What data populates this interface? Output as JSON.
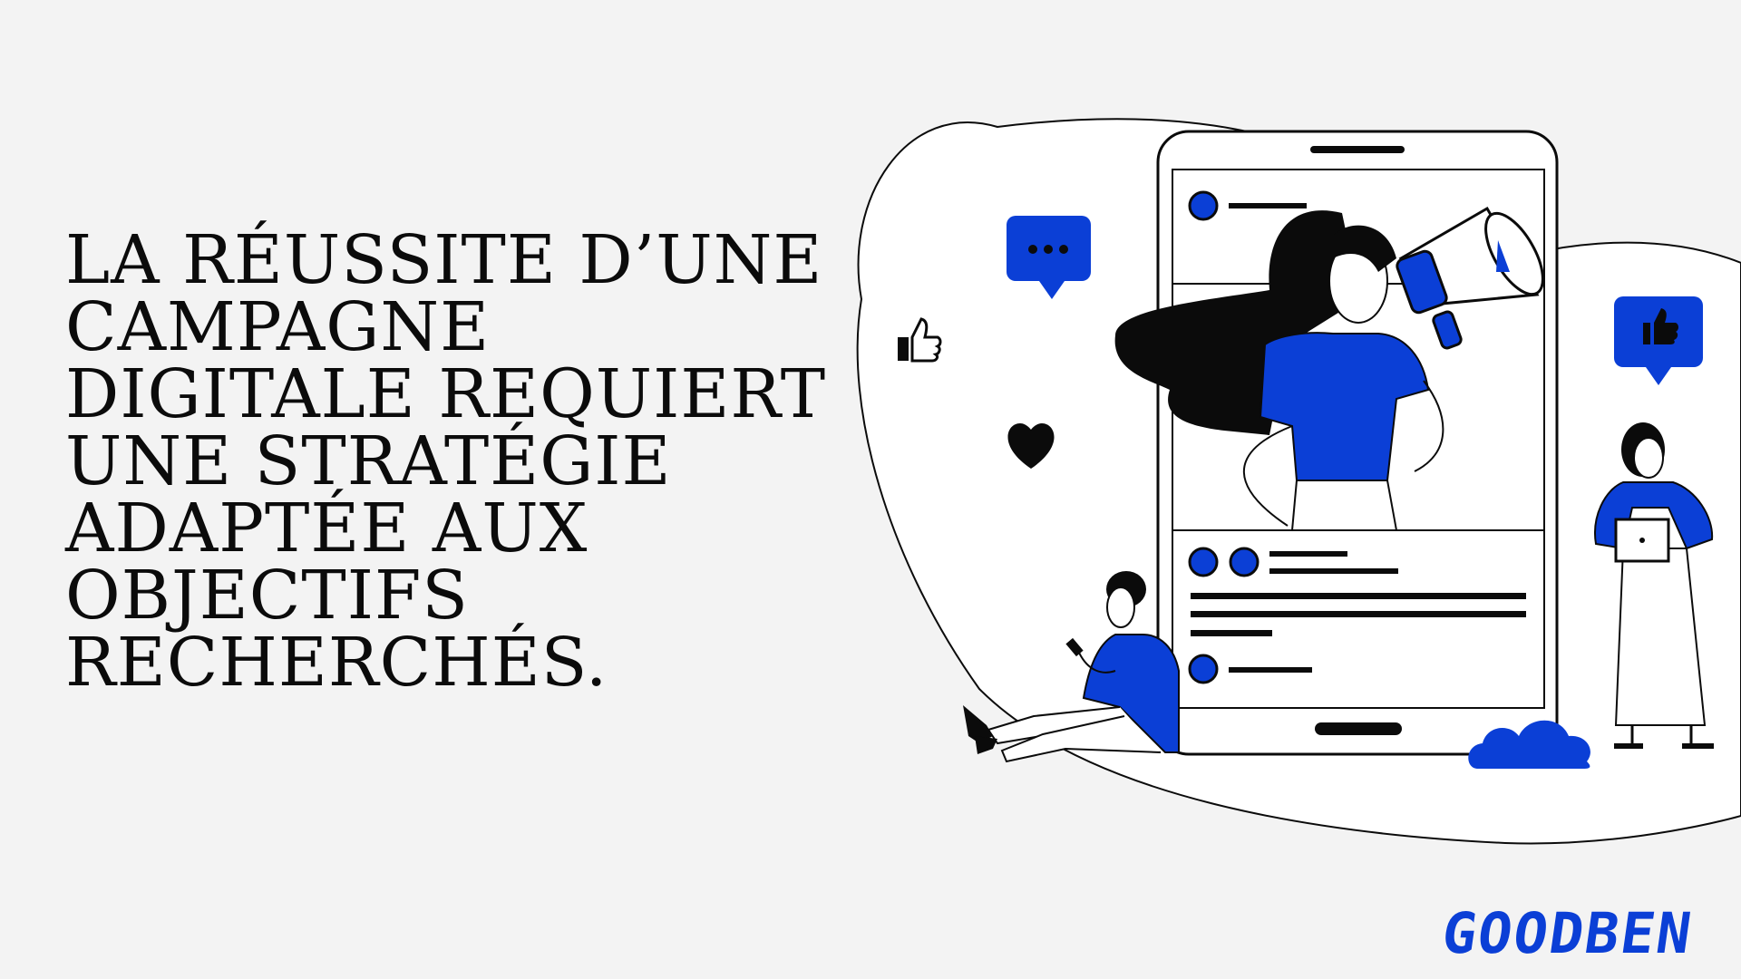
{
  "headline": {
    "lines": [
      "LA RÉUSSITE D’UNE",
      "CAMPAGNE",
      "DIGITALE REQUIERT",
      "UNE STRATÉGIE",
      "ADAPTÉE AUX",
      "OBJECTIFS",
      "RECHERCHÉS."
    ]
  },
  "brand": {
    "name": "GOODBEN"
  },
  "colors": {
    "background": "#f3f3f3",
    "accent_blue": "#0b3fd6",
    "ink": "#0b0b0b",
    "blob": "#ffffff"
  },
  "illustration": {
    "icons": [
      "speech-bubble-ellipsis-icon",
      "thumbs-up-icon",
      "heart-icon",
      "thumbs-up-bubble-icon",
      "cloud-icon",
      "megaphone-icon"
    ]
  }
}
